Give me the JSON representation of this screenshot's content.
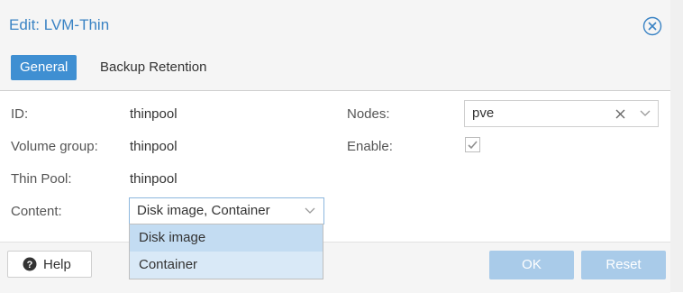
{
  "dialog": {
    "title": "Edit: LVM-Thin",
    "tabs": [
      {
        "label": "General",
        "active": true
      },
      {
        "label": "Backup Retention",
        "active": false
      }
    ]
  },
  "form": {
    "id": {
      "label": "ID:",
      "value": "thinpool"
    },
    "volume_group": {
      "label": "Volume group:",
      "value": "thinpool"
    },
    "thin_pool": {
      "label": "Thin Pool:",
      "value": "thinpool"
    },
    "content": {
      "label": "Content:",
      "value": "Disk image, Container"
    },
    "nodes": {
      "label": "Nodes:",
      "value": "pve"
    },
    "enable": {
      "label": "Enable:",
      "checked": true
    }
  },
  "dropdown": {
    "options": [
      "Disk image",
      "Container"
    ]
  },
  "footer": {
    "help_label": "Help",
    "ok_label": "OK",
    "reset_label": "Reset"
  },
  "colors": {
    "accent": "#3f8fd2",
    "title": "#3a83c4",
    "disabled_button": "#a9cbe9",
    "selected_option": "#c3dcf2"
  }
}
